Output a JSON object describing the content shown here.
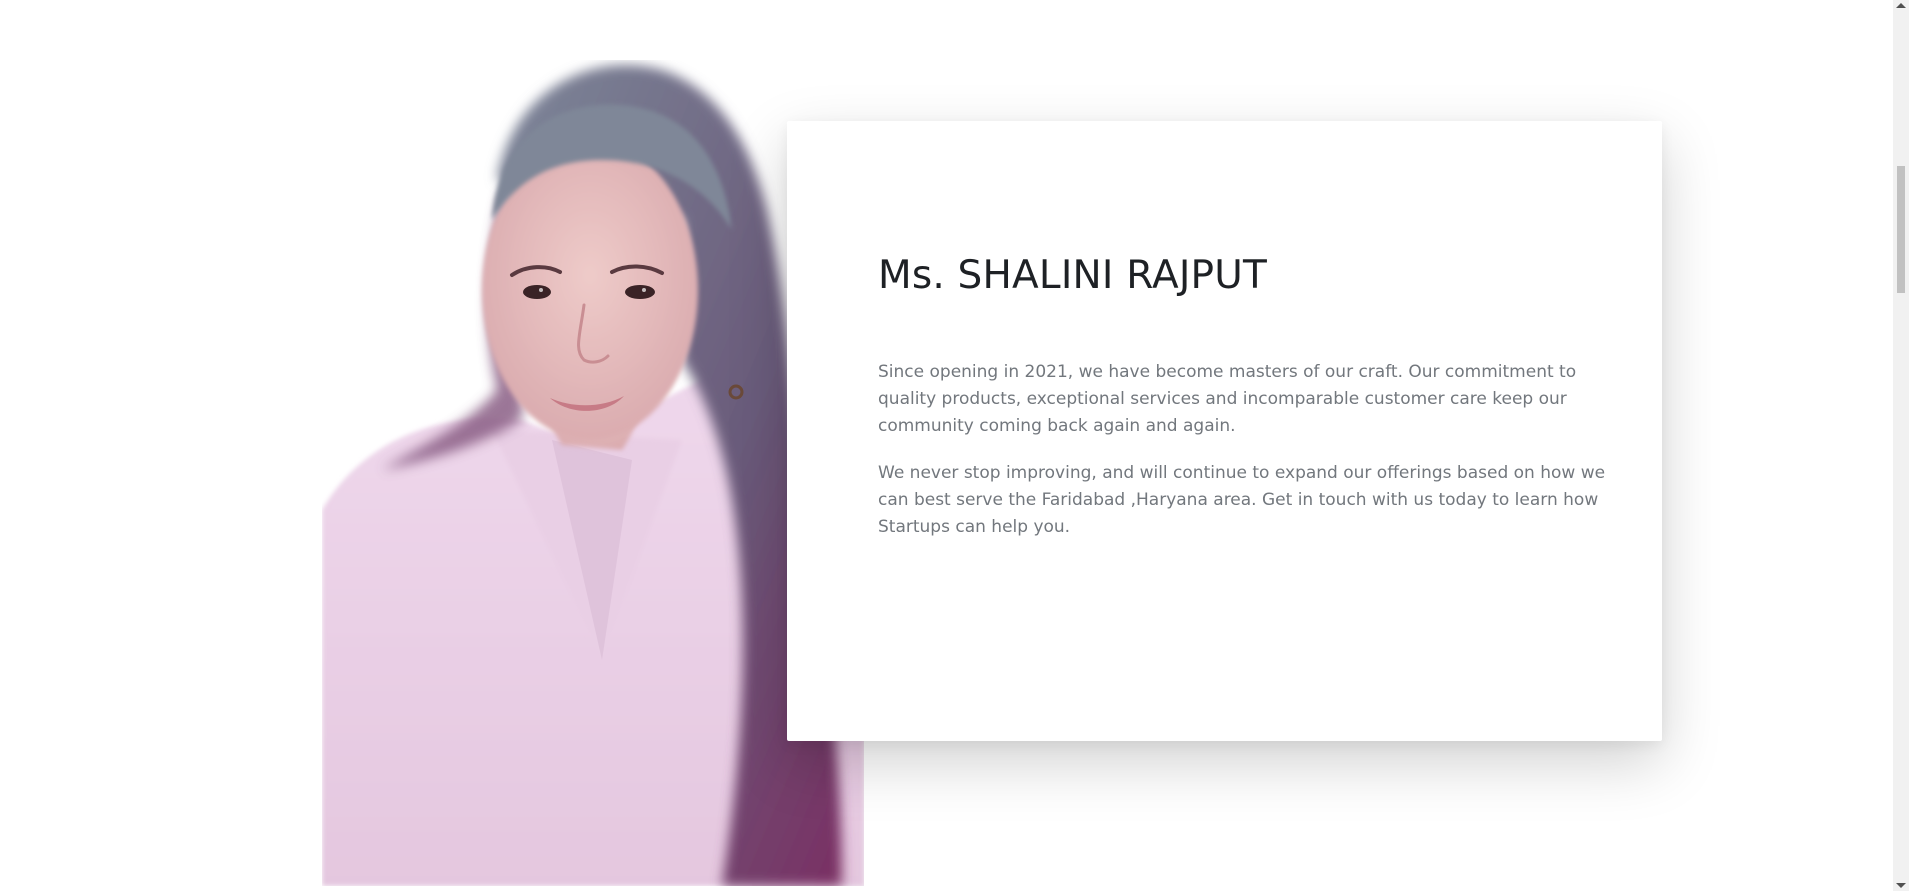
{
  "profile": {
    "name": "Ms. SHALINI RAJPUT",
    "paragraphs": [
      "Since opening in 2021, we have become masters of our craft. Our commitment to quality products, exceptional services and incomparable customer care keep our community coming back again and again.",
      "We never stop improving, and will continue to expand our offerings based on how we can best serve the Faridabad ,Haryana area. Get in touch with us today to learn how Startups can help you."
    ],
    "photo_icon": "portrait-photo"
  },
  "colors": {
    "heading": "#1e2125",
    "body_text": "#72777d",
    "card_bg": "#ffffff",
    "page_bg": "#ffffff"
  }
}
